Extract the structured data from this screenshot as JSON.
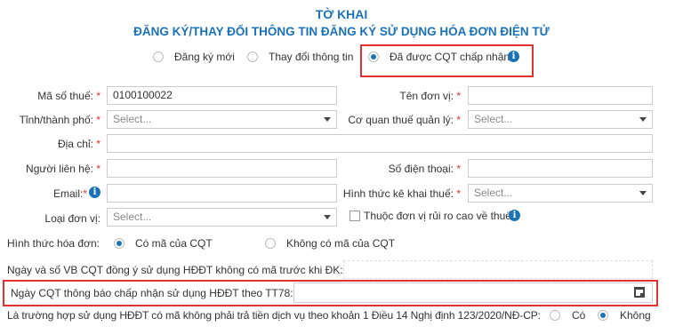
{
  "header": {
    "title": "TỜ KHAI",
    "subtitle": "ĐĂNG KÝ/THAY ĐỔI THÔNG TIN ĐĂNG KÝ SỬ DỤNG HÓA ĐƠN ĐIỆN TỬ"
  },
  "mode": {
    "options": [
      "Đăng ký mới",
      "Thay đổi thông tin",
      "Đã được CQT chấp nhận"
    ],
    "selected": "Đã được CQT chấp nhận"
  },
  "form": {
    "tax_code_label": "Mã số thuế:",
    "tax_code_value": "0100100022",
    "unit_name_label": "Tên đơn vị:",
    "province_label": "Tỉnh/thành phố:",
    "province_placeholder": "Select...",
    "tax_office_label": "Cơ quan thuế quản lý:",
    "tax_office_placeholder": "Select...",
    "address_label": "Địa chỉ:",
    "contact_label": "Người liên hệ:",
    "phone_label": "Số điện thoại:",
    "email_label": "Email:",
    "declare_method_label": "Hình thức kê khai thuế:",
    "declare_method_placeholder": "Select...",
    "unit_type_label": "Loại đơn vị:",
    "unit_type_placeholder": "Select...",
    "high_risk_label": "Thuộc đơn vị rủi ro cao về thuế",
    "required_mark": "*",
    "info_glyph": "i",
    "invoice_type_label": "Hình thức hóa đơn:",
    "invoice_type_options": [
      "Có mã của CQT",
      "Không có mã của CQT"
    ],
    "invoice_type_selected": "Có mã của CQT",
    "doc_no_label": "Ngày và số VB CQT đồng ý sử dụng HĐĐT không có mã trước khi ĐK:",
    "tt78_date_label": "Ngày CQT thông báo chấp nhận sử dụng HĐĐT theo TT78:",
    "free_service_label": "Là trường hợp sử dụng HĐĐT có mã không phải trả tiền dịch vụ theo khoản 1 Điều 14 Nghị định 123/2020/NĐ-CP:",
    "free_service_options": [
      "Có",
      "Không"
    ],
    "free_service_selected": "Không"
  },
  "colors": {
    "accent": "#1a72b8",
    "highlight": "#e03030"
  }
}
